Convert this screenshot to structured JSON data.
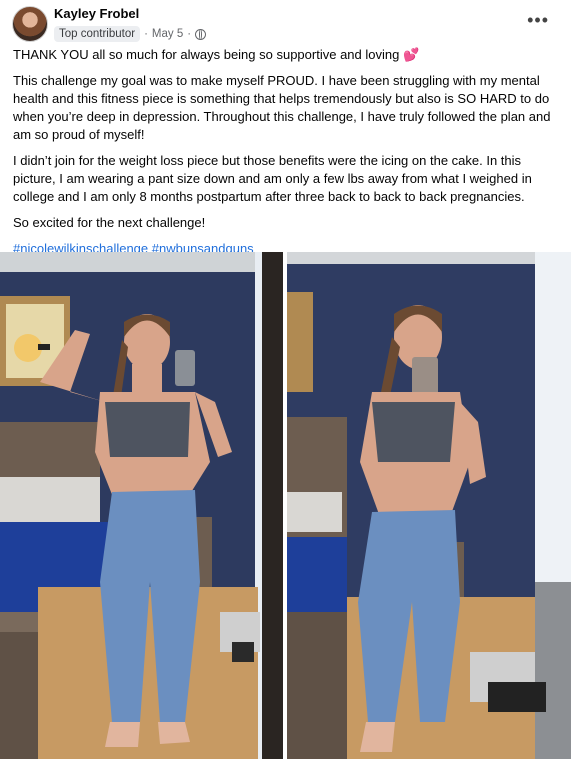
{
  "post": {
    "author": "Kayley Frobel",
    "badge": "Top contributor",
    "date": "May 5",
    "separator": "·",
    "menu_icon": "more-options-icon",
    "paragraphs": [
      "THANK YOU all so much for always being so supportive and loving 💕",
      "This challenge my goal was to make myself PROUD. I have been struggling with my mental health and this fitness piece is something that helps tremendously but also is SO HARD to do when you’re deep in depression. Throughout this challenge, I have truly followed the plan and am so proud of myself!",
      "I didn’t join for the weight loss piece but those benefits were the icing on the cake. In this picture, I am wearing a pant size down and am only a few lbs away from what I weighed in college and I am only 8 months postpartum after three back to back to back pregnancies.",
      "So excited for the next challenge!"
    ],
    "hashtags": [
      "#nicolewilkinschallenge",
      "#nwbunsandguns"
    ]
  },
  "images": {
    "left": "progress-photo-flexing",
    "right": "progress-photo-posing"
  }
}
